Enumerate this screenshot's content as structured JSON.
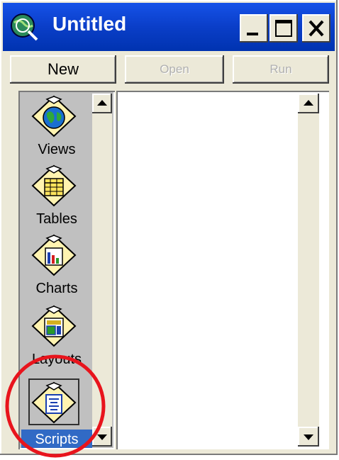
{
  "window": {
    "title": "Untitled",
    "caption_buttons": [
      "minimize-icon",
      "maximize-icon",
      "close-icon"
    ]
  },
  "toolbar": {
    "new_label": "New",
    "open_label": "Open",
    "run_label": "Run"
  },
  "doc_types": [
    {
      "label": "Views",
      "icon": "globe-icon"
    },
    {
      "label": "Tables",
      "icon": "table-icon"
    },
    {
      "label": "Charts",
      "icon": "chart-icon"
    },
    {
      "label": "Layouts",
      "icon": "layout-icon"
    },
    {
      "label": "Scripts",
      "icon": "script-icon",
      "selected": true
    }
  ],
  "colors": {
    "title_bar": "#0a3ec8",
    "selection": "#316ac5",
    "annotation_circle": "#e8141c"
  }
}
